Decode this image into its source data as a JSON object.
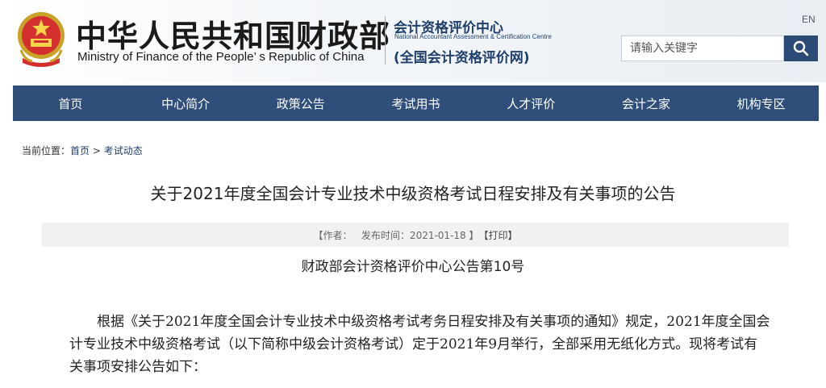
{
  "header": {
    "ministry_cn": "中华人民共和国财政部",
    "ministry_en": "Ministry of Finance of the People’ s Republic of China",
    "centre_cn": "会计资格评价中心",
    "centre_en": "National Accountant Assessment & Certification Centre",
    "centre_net": "(全国会计资格评价网)",
    "lang_label": "EN",
    "emblem_icon": "national-emblem-icon",
    "search_placeholder": "请输入关键字",
    "search_icon": "search-icon"
  },
  "colors": {
    "nav_bg": "#2f4f7a",
    "search_btn_bg": "#2b4a75",
    "brand_blue": "#1f3f6b"
  },
  "nav": {
    "items": [
      {
        "label": "首页"
      },
      {
        "label": "中心简介"
      },
      {
        "label": "政策公告"
      },
      {
        "label": "考试用书"
      },
      {
        "label": "人才评价"
      },
      {
        "label": "会计之家"
      },
      {
        "label": "机构专区"
      }
    ]
  },
  "breadcrumb": {
    "prefix": "当前位置：",
    "home": "首页",
    "separator": " > ",
    "current": "考试动态"
  },
  "article": {
    "title": "关于2021年度全国会计专业技术中级资格考试日程安排及有关事项的公告",
    "meta_author": "【作者：   发布时间：2021-01-18 】",
    "meta_print": "【打印】",
    "subtitle": "财政部会计资格评价中心公告第10号",
    "paragraph": "根据《关于2021年度全国会计专业技术中级资格考试考务日程安排及有关事项的通知》规定，2021年度全国会计专业技术中级资格考试（以下简称中级会计资格考试）定于2021年9月举行，全部采用无纸化方式。现将考试有关事项安排公告如下："
  }
}
